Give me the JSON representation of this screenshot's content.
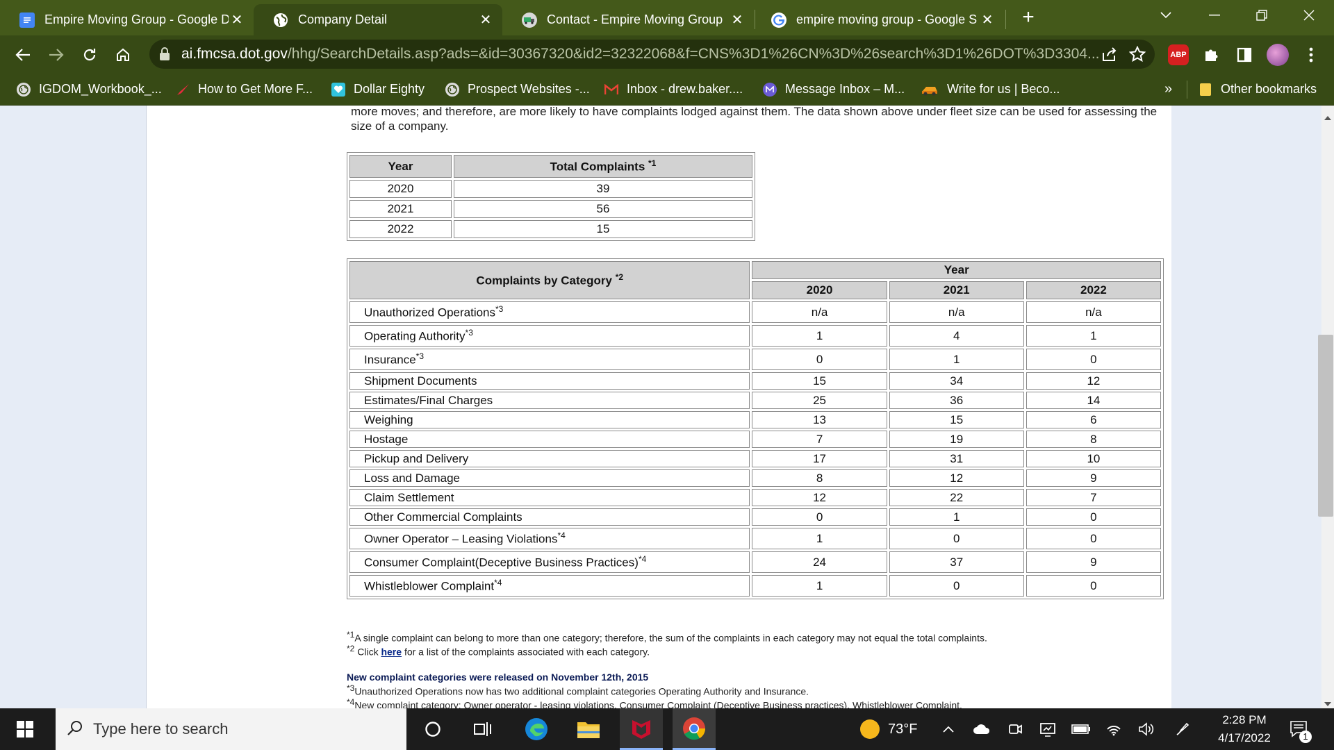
{
  "browser": {
    "tabs": [
      {
        "title": "Empire Moving Group - Google D",
        "icon": "google-docs-icon",
        "color": "#4285f4"
      },
      {
        "title": "Company Detail",
        "icon": "globe-icon",
        "color": "#ffffff"
      },
      {
        "title": "Contact - Empire Moving Group",
        "icon": "truck-icon",
        "color": "#dddddd"
      },
      {
        "title": "empire moving group - Google S",
        "icon": "google-icon",
        "color": "#ffffff"
      }
    ],
    "new_tab": "+",
    "url_domain": "ai.fmcsa.dot.gov",
    "url_path": "/hhg/SearchDetails.asp?ads=&id=30367320&id2=32322068&f=CNS%3D1%26CN%3D%26search%3D1%26DOT%3D3304...",
    "abp_label": "ABP",
    "bookmarks": [
      {
        "label": "IGDOM_Workbook_...",
        "icon": "globe-icon"
      },
      {
        "label": "How to Get More F...",
        "icon": "rocket-icon"
      },
      {
        "label": "Dollar Eighty",
        "icon": "heart-icon"
      },
      {
        "label": "Prospect Websites -...",
        "icon": "globe-icon"
      },
      {
        "label": "Inbox - drew.baker....",
        "icon": "gmail-icon"
      },
      {
        "label": "Message Inbox – M...",
        "icon": "messenger-icon"
      },
      {
        "label": "Write for us | Beco...",
        "icon": "car-icon"
      }
    ],
    "bookmarks_overflow": "»",
    "other_bookmarks": "Other bookmarks"
  },
  "page": {
    "intro_text": "more moves; and therefore, are more likely to have complaints lodged against them. The data shown above under fleet size can be used for assessing the size of a company.",
    "totals_table": {
      "year_header": "Year",
      "total_header": "Total Complaints",
      "total_note": "*1",
      "rows": [
        {
          "year": "2020",
          "total": "39"
        },
        {
          "year": "2021",
          "total": "56"
        },
        {
          "year": "2022",
          "total": "15"
        }
      ]
    },
    "category_table": {
      "category_header": "Complaints by Category",
      "category_note": "*2",
      "year_header": "Year",
      "years": [
        "2020",
        "2021",
        "2022"
      ],
      "rows": [
        {
          "label": "Unauthorized Operations",
          "note": "*3",
          "values": [
            "n/a",
            "n/a",
            "n/a"
          ]
        },
        {
          "label": "Operating Authority",
          "note": "*3",
          "values": [
            "1",
            "4",
            "1"
          ]
        },
        {
          "label": "Insurance",
          "note": "*3",
          "values": [
            "0",
            "1",
            "0"
          ]
        },
        {
          "label": "Shipment Documents",
          "note": "",
          "values": [
            "15",
            "34",
            "12"
          ]
        },
        {
          "label": "Estimates/Final Charges",
          "note": "",
          "values": [
            "25",
            "36",
            "14"
          ]
        },
        {
          "label": "Weighing",
          "note": "",
          "values": [
            "13",
            "15",
            "6"
          ]
        },
        {
          "label": "Hostage",
          "note": "",
          "values": [
            "7",
            "19",
            "8"
          ]
        },
        {
          "label": "Pickup and Delivery",
          "note": "",
          "values": [
            "17",
            "31",
            "10"
          ]
        },
        {
          "label": "Loss and Damage",
          "note": "",
          "values": [
            "8",
            "12",
            "9"
          ]
        },
        {
          "label": "Claim Settlement",
          "note": "",
          "values": [
            "12",
            "22",
            "7"
          ]
        },
        {
          "label": "Other Commercial Complaints",
          "note": "",
          "values": [
            "0",
            "1",
            "0"
          ]
        },
        {
          "label": "Owner Operator – Leasing Violations",
          "note": "*4",
          "values": [
            "1",
            "0",
            "0"
          ]
        },
        {
          "label": "Consumer Complaint(Deceptive Business Practices)",
          "note": "*4",
          "values": [
            "24",
            "37",
            "9"
          ]
        },
        {
          "label": "Whistleblower Complaint",
          "note": "*4",
          "values": [
            "1",
            "0",
            "0"
          ]
        }
      ]
    },
    "footnotes": {
      "n1_mark": "*1",
      "n1_text": "A single complaint can belong to more than one category; therefore, the sum of the complaints in each category may not equal the total complaints.",
      "n2_mark": "*2",
      "n2_pre": "Click",
      "n2_link": "here",
      "n2_post": "for a list of the complaints associated with each category.",
      "release_title": "New complaint categories were released on November 12th, 2015",
      "n3_mark": "*3",
      "n3_text": "Unauthorized Operations now has two additional complaint categories Operating Authority and Insurance.",
      "n4_mark": "*4",
      "n4_text": "New complaint category: Owner operator - leasing violations, Consumer Complaint (Deceptive Business practices), Whistleblower Complaint."
    }
  },
  "taskbar": {
    "search_placeholder": "Type here to search",
    "weather": "73°F",
    "time": "2:28 PM",
    "date": "4/17/2022",
    "notification_count": "1"
  }
}
